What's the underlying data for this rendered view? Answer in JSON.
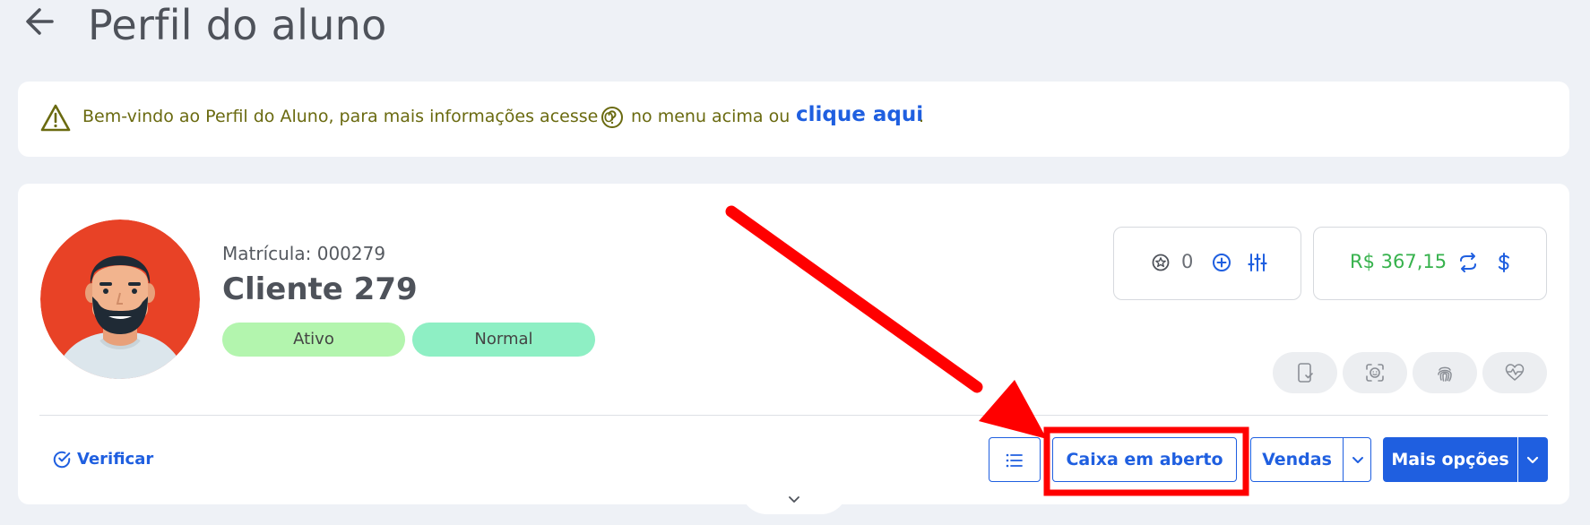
{
  "header": {
    "title": "Perfil do aluno",
    "back_icon": "arrow-left-icon"
  },
  "alert": {
    "text_before": "Bem-vindo ao Perfil do Aluno, para mais informações acesse o",
    "text_middle": "no menu acima ou",
    "link_text": "clique aqui",
    "text_after": ".",
    "warning_icon": "warning-triangle-icon",
    "help_icon": "question-circle-icon",
    "text_color": "#6a6a10",
    "link_color": "#1f5fe0"
  },
  "profile": {
    "matricula": "Matrícula: 000279",
    "name": "Cliente 279",
    "badges": [
      {
        "label": "Ativo",
        "color": "#b3f5ae"
      },
      {
        "label": "Normal",
        "color": "#8eefc4"
      }
    ],
    "points": "0",
    "balance": "R$ 367,15",
    "balance_color": "#37b24d"
  },
  "quick_actions": [
    {
      "icon": "phone-check-icon"
    },
    {
      "icon": "face-scan-icon"
    },
    {
      "icon": "fingerprint-icon"
    },
    {
      "icon": "heart-pulse-icon"
    }
  ],
  "footer_actions": {
    "verify_label": "Verificar",
    "list_icon": "list-icon",
    "caixa_label": "Caixa em aberto",
    "vendas_label": "Vendas",
    "mais_opcoes_label": "Mais opções"
  },
  "colors": {
    "accent": "#1f5fe0",
    "background": "#eef1f6",
    "annotation_red": "#ff0000"
  }
}
